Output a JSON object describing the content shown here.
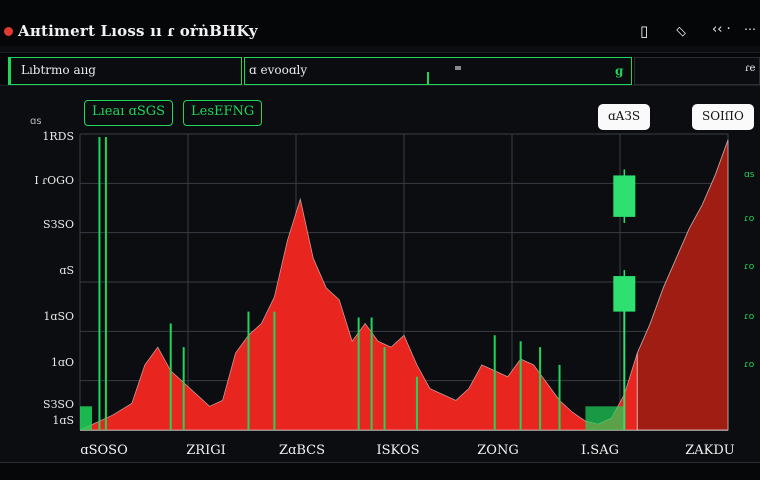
{
  "window": {
    "title": "Aнtimert Lıoss ıı ɾ oṙṅBHKy",
    "icons": [
      "record-icon",
      "square-icon",
      "diamond-icon",
      "back-forward-icon",
      "more-icon"
    ]
  },
  "toolbar": {
    "left_label": "Lıbtrmo aııg",
    "mid_label": "ɑ evooɑly",
    "right_marker": "ɡ",
    "side_marker": "ɾe"
  },
  "badges": {
    "green_1": "Lıeaı ɑSGS",
    "green_2": "LesEFNG",
    "white_1": "ɑAЗS",
    "white_2": "SOIſIO"
  },
  "y_axis": {
    "unit_label": "ɑs",
    "ticks": [
      "1RDS",
      "I ɾOGO",
      "SЗSO",
      "ɑS",
      "1ɑSO",
      "1ɑO",
      "SЗSO",
      "1ɑS"
    ]
  },
  "x_axis": {
    "ticks": [
      "ɑSOSO",
      "ZRIGI",
      "ZɑBCS",
      "ISKOS",
      "ZONG",
      "I.SAG",
      "ZAKDU"
    ]
  },
  "right_axis": [
    "ɑs",
    "ɾo",
    "ɾo",
    "ɾo",
    "ɾo"
  ],
  "colors": {
    "background": "#0b0d11",
    "grid": "#3a3d44",
    "red_series": "#e8261f",
    "dark_red_series": "#a01d14",
    "green": "#1fd65a",
    "candle": "#2ee070"
  },
  "chart_data": {
    "type": "area",
    "title": "",
    "xlabel": "",
    "ylabel": "",
    "x": [
      0,
      2,
      5,
      8,
      10,
      12,
      14,
      16,
      18,
      20,
      22,
      24,
      26,
      28,
      30,
      32,
      34,
      36,
      38,
      40,
      42,
      44,
      46,
      48,
      50,
      52,
      54,
      56,
      58,
      60,
      62,
      64,
      66,
      68,
      70,
      72,
      74,
      76,
      78,
      80,
      82,
      84,
      86,
      88,
      90,
      92,
      94,
      96,
      98,
      100
    ],
    "ylim": [
      0,
      100
    ],
    "series": [
      {
        "values": [
          0,
          2,
          5,
          9,
          22,
          28,
          20,
          16,
          12,
          8,
          10,
          26,
          32,
          36,
          45,
          64,
          78,
          58,
          48,
          44,
          30,
          36,
          30,
          28,
          32,
          22,
          14,
          12,
          10,
          14,
          22,
          20,
          18,
          24,
          22,
          16,
          10,
          6,
          3,
          2,
          4,
          12,
          26,
          36,
          48,
          58,
          68,
          76,
          86,
          98
        ]
      }
    ],
    "spikes_green": [
      {
        "x": 4,
        "value": 99
      },
      {
        "x": 14,
        "value": 36
      },
      {
        "x": 16,
        "value": 28
      },
      {
        "x": 26,
        "value": 40
      },
      {
        "x": 30,
        "value": 40
      },
      {
        "x": 43,
        "value": 38
      },
      {
        "x": 45,
        "value": 38
      },
      {
        "x": 47,
        "value": 28
      },
      {
        "x": 52,
        "value": 18
      },
      {
        "x": 64,
        "value": 32
      },
      {
        "x": 68,
        "value": 30
      },
      {
        "x": 71,
        "value": 28
      },
      {
        "x": 74,
        "value": 22
      }
    ],
    "candles": [
      {
        "x": 84,
        "open": 72,
        "close": 86
      },
      {
        "x": 84,
        "open": 40,
        "close": 52
      }
    ],
    "grid": true
  }
}
